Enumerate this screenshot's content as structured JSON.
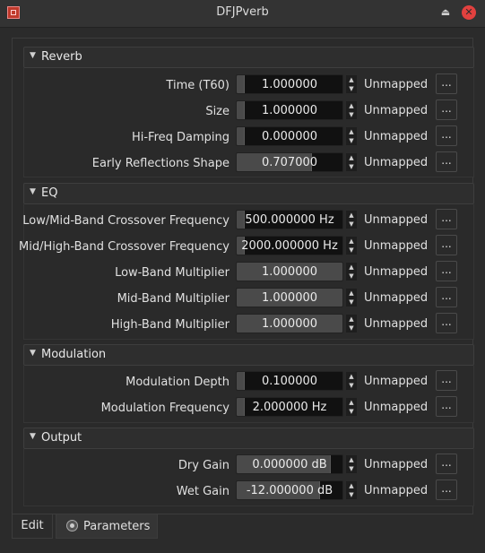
{
  "window": {
    "title": "DFJPverb",
    "shade_icon": "⏏",
    "close_icon": "✕"
  },
  "colors": {
    "titlebar": "#333333",
    "close": "#e2413f",
    "slider_bg": "#111111",
    "slider_fill": "#4a4a4a"
  },
  "sections": {
    "reverb": {
      "title": "Reverb",
      "params": [
        {
          "label": "Time (T60)",
          "value": "1.000000",
          "mapping": "Unmapped",
          "fraction": 0.0
        },
        {
          "label": "Size",
          "value": "1.000000",
          "mapping": "Unmapped",
          "fraction": 0.0
        },
        {
          "label": "Hi-Freq Damping",
          "value": "0.000000",
          "mapping": "Unmapped",
          "fraction": 0.0
        },
        {
          "label": "Early Reflections Shape",
          "value": "0.707000",
          "mapping": "Unmapped",
          "fraction": 0.707
        }
      ]
    },
    "eq": {
      "title": "EQ",
      "params": [
        {
          "label": "Low/Mid-Band Crossover Frequency",
          "value": "500.000000 Hz",
          "mapping": "Unmapped",
          "fraction": 0.0
        },
        {
          "label": "Mid/High-Band Crossover Frequency",
          "value": "2000.000000 Hz",
          "mapping": "Unmapped",
          "fraction": 0.0
        },
        {
          "label": "Low-Band Multiplier",
          "value": "1.000000",
          "mapping": "Unmapped",
          "fraction": 1.0
        },
        {
          "label": "Mid-Band Multiplier",
          "value": "1.000000",
          "mapping": "Unmapped",
          "fraction": 1.0
        },
        {
          "label": "High-Band Multiplier",
          "value": "1.000000",
          "mapping": "Unmapped",
          "fraction": 1.0
        }
      ]
    },
    "modulation": {
      "title": "Modulation",
      "params": [
        {
          "label": "Modulation Depth",
          "value": "0.100000",
          "mapping": "Unmapped",
          "fraction": 0.0
        },
        {
          "label": "Modulation Frequency",
          "value": "2.000000 Hz",
          "mapping": "Unmapped",
          "fraction": 0.0
        }
      ]
    },
    "output": {
      "title": "Output",
      "params": [
        {
          "label": "Dry Gain",
          "value": "0.000000 dB",
          "mapping": "Unmapped",
          "fraction": 0.88
        },
        {
          "label": "Wet Gain",
          "value": "-12.000000 dB",
          "mapping": "Unmapped",
          "fraction": 0.78
        }
      ]
    }
  },
  "more_label": "...",
  "tabs": {
    "edit": "Edit",
    "parameters": "Parameters"
  }
}
